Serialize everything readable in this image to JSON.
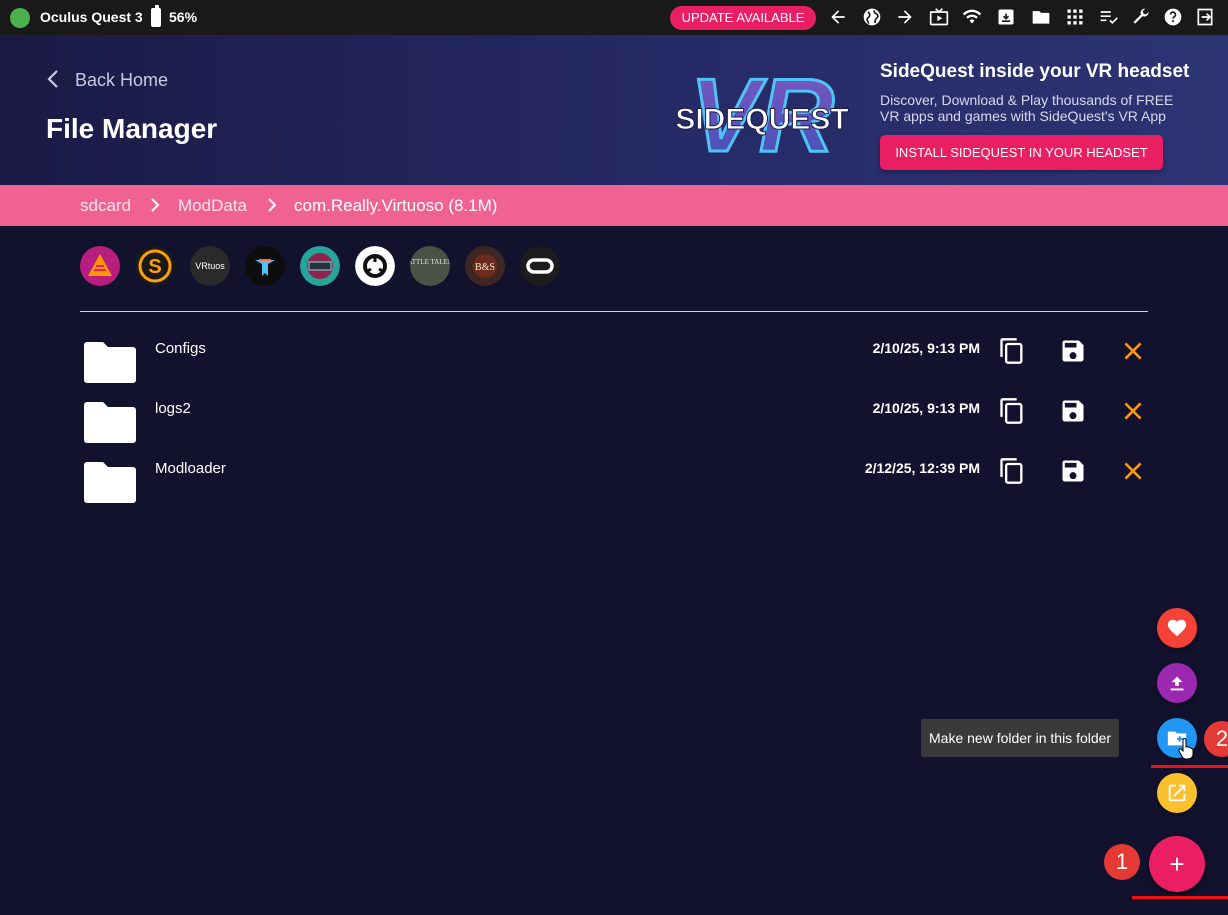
{
  "topbar": {
    "device_name": "Oculus Quest 3",
    "battery": "56%",
    "update_label": "UPDATE AVAILABLE",
    "icons": [
      "back-arrow-icon",
      "globe-icon",
      "forward-arrow-icon",
      "tv-icon",
      "wifi-icon",
      "download-box-icon",
      "folder-icon",
      "apps-grid-icon",
      "task-list-icon",
      "wrench-icon",
      "help-icon",
      "exit-icon"
    ]
  },
  "header": {
    "back_label": "Back Home",
    "title": "File Manager",
    "promo": {
      "title": "SideQuest inside your VR headset",
      "description": "Discover, Download & Play thousands of FREE VR apps and games with SideQuest's VR App",
      "install_label": "INSTALL SIDEQUEST IN YOUR HEADSET",
      "logo_big_text": "VR",
      "logo_text": "SIDEQUEST"
    }
  },
  "breadcrumb": [
    "sdcard",
    "ModData",
    "com.Really.Virtuoso (8.1M)"
  ],
  "app_icons": [
    {
      "name": "app-icon-1",
      "text": ""
    },
    {
      "name": "app-icon-2",
      "text": "S"
    },
    {
      "name": "app-icon-3",
      "text": "VRtuos"
    },
    {
      "name": "app-icon-4",
      "text": ""
    },
    {
      "name": "app-icon-5",
      "text": ""
    },
    {
      "name": "app-icon-6",
      "text": ""
    },
    {
      "name": "app-icon-7",
      "text": "BATTLE TALENT"
    },
    {
      "name": "app-icon-8",
      "text": "B&S"
    },
    {
      "name": "app-icon-9",
      "text": ""
    }
  ],
  "files": [
    {
      "name": "Configs",
      "date": "2/10/25, 9:13 PM"
    },
    {
      "name": "logs2",
      "date": "2/10/25, 9:13 PM"
    },
    {
      "name": "Modloader",
      "date": "2/12/25, 12:39 PM"
    }
  ],
  "fabs": {
    "tooltip": "Make new folder in this folder",
    "main_label": "+",
    "badge_1": "1",
    "badge_2": "2"
  },
  "colors": {
    "accent": "#e91e63",
    "breadcrumb_bg": "#f06292",
    "page_bg": "#12122e",
    "delete_icon": "#ff9800",
    "fab_heart": "#f44336",
    "fab_upload": "#9c27b0",
    "fab_folder": "#2196f3",
    "fab_open": "#fbc02d"
  }
}
